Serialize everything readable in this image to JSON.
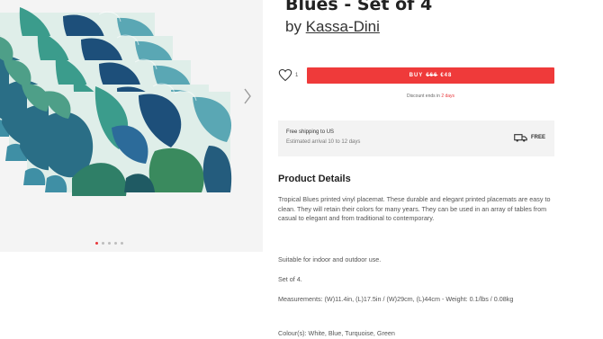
{
  "product": {
    "title": "Blues - Set of 4",
    "by_prefix": "by",
    "shop_name": "Kassa-Dini"
  },
  "gallery": {
    "image_count": 5,
    "active_index": 0,
    "next_icon": "chevron-right-icon"
  },
  "favorites": {
    "count": "1",
    "icon": "heart-outline-icon"
  },
  "buy": {
    "label": "BUY",
    "old_price": "€66",
    "price": "€48",
    "color": "#ef3a3a"
  },
  "discount": {
    "text": "Discount ends in",
    "days": "2 days"
  },
  "shipping": {
    "line1": "Free shipping to US",
    "line2": "Estimated arrival 10 to 12 days",
    "badge": "FREE",
    "icon": "truck-icon"
  },
  "details": {
    "heading": "Product Details",
    "paragraphs": [
      "Tropical Blues printed vinyl placemat. These durable and elegant printed placemats are easy to clean. They will retain their colors for many years. They can be used in an array of tables from casual to elegant and from traditional to contemporary.",
      "Suitable for indoor and outdoor use.",
      "Set of 4.",
      "Measurements: (W)11.4in, (L)17.5in / (W)29cm, (L)44cm - Weight: 0.1/lbs / 0.08kg",
      "Colour(s): White, Blue, Turquoise, Green"
    ]
  }
}
